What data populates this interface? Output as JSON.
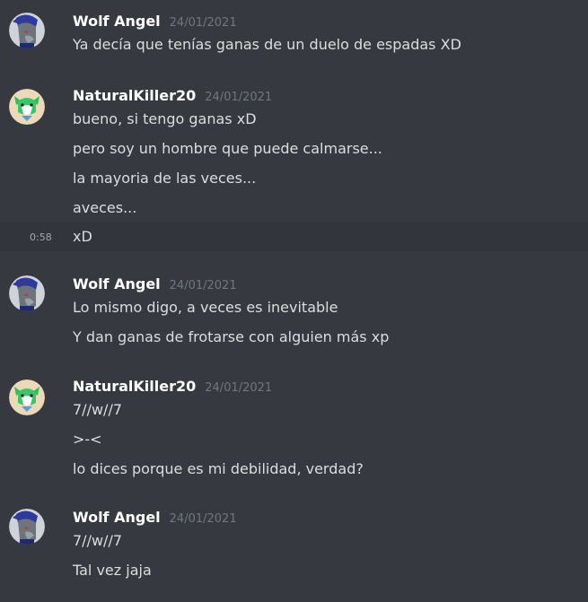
{
  "messages": [
    {
      "author": "Wolf Angel",
      "time": "24/01/2021",
      "avatar": "wolf-avatar",
      "lines": [
        "Ya decía que tenías ganas de un duelo de espadas XD"
      ]
    },
    {
      "author": "NaturalKiller20",
      "time": "24/01/2021",
      "avatar": "green-fox-avatar",
      "lines": [
        "bueno, si tengo ganas xD",
        "pero soy un hombre que puede calmarse...",
        "la mayoria de las  veces...",
        "aveces...",
        "xD"
      ],
      "hover_time": "0:58"
    },
    {
      "author": "Wolf Angel",
      "time": "24/01/2021",
      "avatar": "wolf-avatar",
      "lines": [
        "Lo mismo digo, a veces es inevitable",
        "Y dan ganas de frotarse con alguien más xp"
      ]
    },
    {
      "author": "NaturalKiller20",
      "time": "24/01/2021",
      "avatar": "green-fox-avatar",
      "lines": [
        "7//w//7",
        ">-<",
        "lo dices porque es mi debilidad, verdad?"
      ]
    },
    {
      "author": "Wolf Angel",
      "time": "24/01/2021",
      "avatar": "wolf-avatar",
      "lines": [
        "7//w//7",
        "Tal vez jaja"
      ]
    }
  ],
  "colors": {
    "background": "#36393f",
    "hover_row": "#32353b",
    "username": "#ffffff",
    "timestamp": "#72767d",
    "text": "#dcddde"
  }
}
